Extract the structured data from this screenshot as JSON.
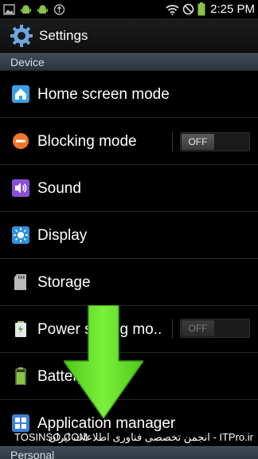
{
  "status_bar": {
    "time": "2:25 PM",
    "left_icons": [
      "image-notification-icon",
      "android-notification-icon",
      "android-notification-icon",
      "usb-notification-icon"
    ],
    "right_icons": [
      "wifi-icon",
      "no-signal-icon",
      "battery-icon"
    ]
  },
  "action_bar": {
    "title": "Settings",
    "icon": "settings-gear-icon"
  },
  "sections": {
    "device": "Device",
    "personal": "Personal"
  },
  "rows": [
    {
      "label": "Home screen mode",
      "icon": "home-icon"
    },
    {
      "label": "Blocking mode",
      "icon": "block-icon",
      "toggle": "OFF"
    },
    {
      "label": "Sound",
      "icon": "sound-icon"
    },
    {
      "label": "Display",
      "icon": "display-icon"
    },
    {
      "label": "Storage",
      "icon": "storage-icon"
    },
    {
      "label": "Power saving mo..",
      "icon": "power-saving-icon",
      "toggle": "OFF"
    },
    {
      "label": "Battery",
      "icon": "battery-icon"
    },
    {
      "label": "Application manager",
      "icon": "app-manager-icon"
    }
  ],
  "overlay": {
    "arrow_color": "#6fe32a",
    "arrow_icon": "down-arrow-icon"
  },
  "watermark": {
    "left": "TOSINSO.COM",
    "right": "انجمن تخصصی فناوری اطلاعات ایران - ITPro.ir"
  }
}
